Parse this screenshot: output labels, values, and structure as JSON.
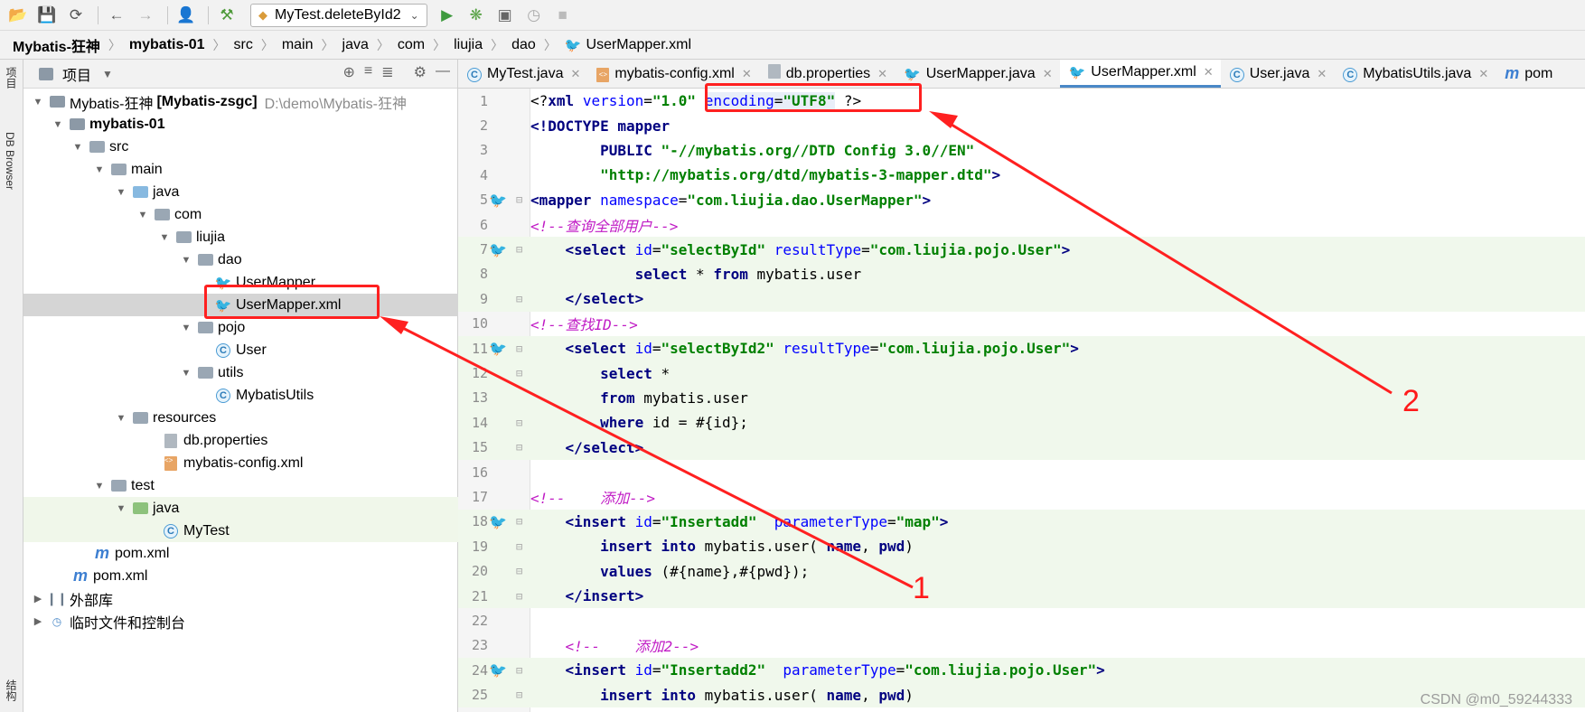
{
  "toolbar": {
    "run_config": "MyTest.deleteById2",
    "icons": [
      "open-folder-icon",
      "save-icon",
      "sync-icon",
      "back-icon",
      "forward-icon",
      "user-icon",
      "build-hammer-icon",
      "run-icon",
      "debug-icon",
      "coverage-icon",
      "profile-icon",
      "stop-icon"
    ]
  },
  "breadcrumb": [
    "Mybatis-狂神",
    "mybatis-01",
    "src",
    "main",
    "java",
    "com",
    "liujia",
    "dao",
    "UserMapper.xml"
  ],
  "left_strip": {
    "project_label": "项目",
    "db_label": "DB Browser",
    "structure_label": "结构"
  },
  "project_panel": {
    "title": "项目",
    "tree": [
      {
        "label": "Mybatis-狂神",
        "extra": "[Mybatis-zsgc]",
        "path": "D:\\demo\\Mybatis-狂神"
      },
      {
        "label": "mybatis-01"
      },
      {
        "label": "src"
      },
      {
        "label": "main"
      },
      {
        "label": "java"
      },
      {
        "label": "com"
      },
      {
        "label": "liujia"
      },
      {
        "label": "dao"
      },
      {
        "label": "UserMapper"
      },
      {
        "label": "UserMapper.xml"
      },
      {
        "label": "pojo"
      },
      {
        "label": "User"
      },
      {
        "label": "utils"
      },
      {
        "label": "MybatisUtils"
      },
      {
        "label": "resources"
      },
      {
        "label": "db.properties"
      },
      {
        "label": "mybatis-config.xml"
      },
      {
        "label": "test"
      },
      {
        "label": "java"
      },
      {
        "label": "MyTest"
      },
      {
        "label": "pom.xml"
      },
      {
        "label": "pom.xml"
      },
      {
        "label": "外部库"
      },
      {
        "label": "临时文件和控制台"
      }
    ]
  },
  "tabs": [
    {
      "label": "MyTest.java"
    },
    {
      "label": "mybatis-config.xml"
    },
    {
      "label": "db.properties"
    },
    {
      "label": "UserMapper.java"
    },
    {
      "label": "UserMapper.xml"
    },
    {
      "label": "User.java"
    },
    {
      "label": "MybatisUtils.java"
    },
    {
      "label": "pom"
    }
  ],
  "editor": {
    "line_numbers": [
      "1",
      "2",
      "3",
      "4",
      "5",
      "6",
      "7",
      "8",
      "9",
      "10",
      "11",
      "12",
      "13",
      "14",
      "15",
      "16",
      "17",
      "18",
      "19",
      "20",
      "21",
      "22",
      "23",
      "24",
      "25"
    ]
  },
  "annotations": {
    "label_1": "1",
    "label_2": "2"
  },
  "watermark": "CSDN @m0_59244333",
  "colors": {
    "accent": "#4a88c7",
    "annotation": "#ff2020",
    "comment": "#c01bc5",
    "string": "#008000",
    "tag": "#000080"
  }
}
